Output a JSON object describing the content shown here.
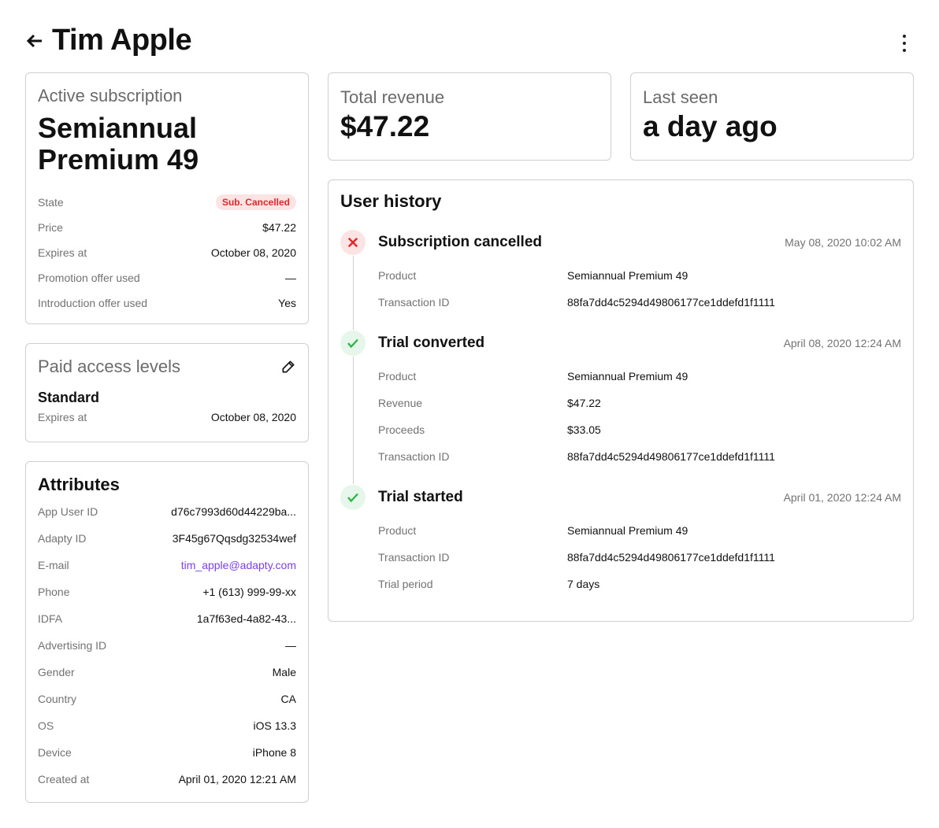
{
  "header": {
    "title": "Tim Apple"
  },
  "subscription": {
    "label": "Active subscription",
    "name": "Semiannual Premium 49",
    "rows": [
      {
        "k": "State",
        "v": "Sub. Cancelled"
      },
      {
        "k": "Price",
        "v": "$47.22"
      },
      {
        "k": "Expires at",
        "v": "October 08, 2020"
      },
      {
        "k": "Promotion offer used",
        "v": "—"
      },
      {
        "k": "Introduction offer used",
        "v": "Yes"
      }
    ]
  },
  "access": {
    "label": "Paid access levels",
    "level": "Standard",
    "expires_label": "Expires at",
    "expires": "October 08, 2020"
  },
  "attributes": {
    "title": "Attributes",
    "rows": [
      {
        "k": "App User ID",
        "v": "d76c7993d60d44229ba..."
      },
      {
        "k": "Adapty ID",
        "v": "3F45g67Qqsdg32534wef"
      },
      {
        "k": "E-mail",
        "v": "tim_apple@adapty.com"
      },
      {
        "k": "Phone",
        "v": "+1 (613) 999-99-xx"
      },
      {
        "k": "IDFA",
        "v": "1a7f63ed-4a82-43..."
      },
      {
        "k": "Advertising ID",
        "v": "—"
      },
      {
        "k": "Gender",
        "v": "Male"
      },
      {
        "k": "Country",
        "v": "CA"
      },
      {
        "k": "OS",
        "v": "iOS 13.3"
      },
      {
        "k": "Device",
        "v": "iPhone 8"
      },
      {
        "k": "Created at",
        "v": "April 01, 2020 12:21 AM"
      }
    ]
  },
  "revenue": {
    "label": "Total revenue",
    "value": "$47.22"
  },
  "last_seen": {
    "label": "Last seen",
    "value": "a day ago"
  },
  "history": {
    "title": "User history",
    "events": [
      {
        "title": "Subscription cancelled",
        "date": "May 08, 2020 10:02 AM",
        "type": "cancel",
        "rows": [
          {
            "k": "Product",
            "v": "Semiannual Premium 49"
          },
          {
            "k": "Transaction ID",
            "v": "88fa7dd4c5294d49806177ce1ddefd1f1111"
          }
        ]
      },
      {
        "title": "Trial converted",
        "date": "April 08, 2020 12:24 AM",
        "type": "ok",
        "rows": [
          {
            "k": "Product",
            "v": "Semiannual Premium 49"
          },
          {
            "k": "Revenue",
            "v": "$47.22"
          },
          {
            "k": "Proceeds",
            "v": "$33.05"
          },
          {
            "k": "Transaction ID",
            "v": "88fa7dd4c5294d49806177ce1ddefd1f1111"
          }
        ]
      },
      {
        "title": "Trial started",
        "date": "April 01, 2020 12:24 AM",
        "type": "ok",
        "rows": [
          {
            "k": "Product",
            "v": "Semiannual Premium 49"
          },
          {
            "k": "Transaction ID",
            "v": "88fa7dd4c5294d49806177ce1ddefd1f1111"
          },
          {
            "k": "Trial period",
            "v": "7 days"
          }
        ]
      }
    ]
  },
  "colors": {
    "accent": "#7b3ff2",
    "danger": "#e0262b",
    "success": "#2fb344"
  }
}
